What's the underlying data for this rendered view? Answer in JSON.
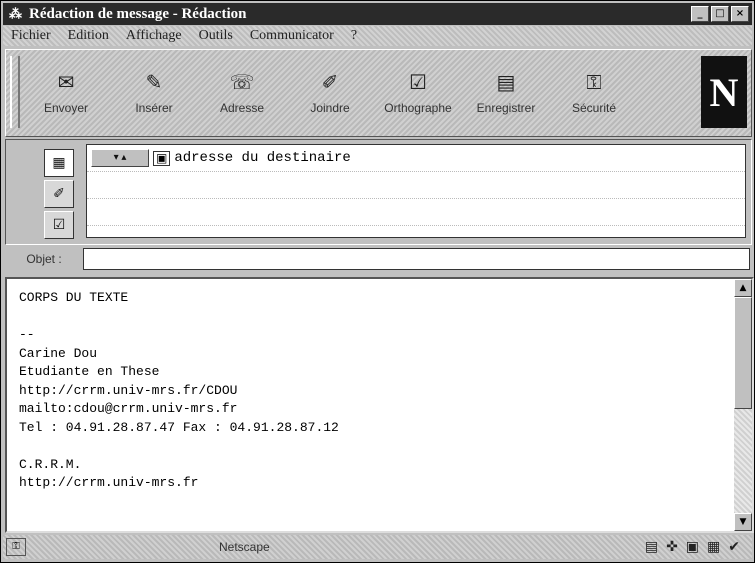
{
  "window": {
    "title": "Rédaction de message - Rédaction",
    "app_icon": "netscape-compose-icon",
    "controls": {
      "minimize": "_",
      "maximize": "□",
      "close": "×"
    }
  },
  "menu": [
    "Fichier",
    "Edition",
    "Affichage",
    "Outils",
    "Communicator",
    "?"
  ],
  "toolbar": {
    "buttons": [
      {
        "label": "Envoyer",
        "icon": "send-icon",
        "glyph": "✉"
      },
      {
        "label": "Insérer",
        "icon": "insert-icon",
        "glyph": "✎"
      },
      {
        "label": "Adresse",
        "icon": "address-icon",
        "glyph": "☏"
      },
      {
        "label": "Joindre",
        "icon": "attach-icon",
        "glyph": "✐"
      },
      {
        "label": "Orthographe",
        "icon": "spelling-icon",
        "glyph": "☑"
      },
      {
        "label": "Enregistrer",
        "icon": "save-icon",
        "glyph": "▤"
      },
      {
        "label": "Sécurité",
        "icon": "security-icon",
        "glyph": "⚿"
      }
    ],
    "logo": "N"
  },
  "address": {
    "tabs": [
      {
        "name": "address-tab",
        "glyph": "▦"
      },
      {
        "name": "attachments-tab",
        "glyph": "✐"
      },
      {
        "name": "options-tab",
        "glyph": "☑"
      }
    ],
    "type_button": "▾ ▴",
    "recipient": "adresse du destinaire"
  },
  "subject": {
    "label": "Objet :",
    "value": ""
  },
  "body": {
    "text": "CORPS DU TEXTE\n\n--\nCarine Dou\nEtudiante en These\nhttp://crrm.univ-mrs.fr/CDOU\nmailto:cdou@crrm.univ-mrs.fr\nTel : 04.91.28.87.47 Fax : 04.91.28.87.12\n\nC.R.R.M.\nhttp://crrm.univ-mrs.fr"
  },
  "status": {
    "text": "Netscape",
    "icons": [
      "▤",
      "✜",
      "▣",
      "▦",
      "✔"
    ]
  }
}
